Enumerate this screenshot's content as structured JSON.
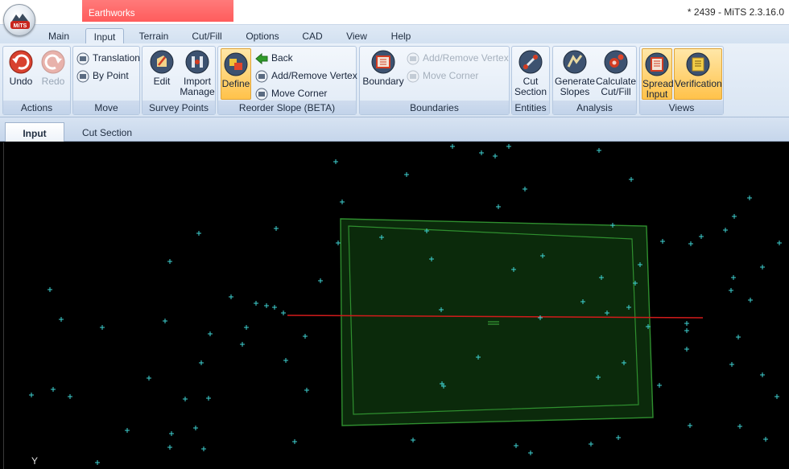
{
  "window": {
    "title": "* 2439 - MiTS 2.3.16.0",
    "context_tab": "Earthworks",
    "orb_text": "MiTS"
  },
  "ribbon_tabs": [
    "Main",
    "Input",
    "Terrain",
    "Cut/Fill",
    "Options",
    "CAD",
    "View",
    "Help"
  ],
  "active_ribbon_tab": "Input",
  "groups": {
    "actions": {
      "label": "Actions",
      "undo": "Undo",
      "redo": "Redo"
    },
    "move": {
      "label": "Move",
      "translation": "Translation",
      "by_point": "By Point"
    },
    "survey_points": {
      "label": "Survey Points",
      "edit": "Edit",
      "import_line1": "Import",
      "import_line2": "Manage"
    },
    "reorder_slope": {
      "label": "Reorder Slope (BETA)",
      "define": "Define",
      "back": "Back",
      "add_remove_vertex": "Add/Remove Vertex",
      "move_corner": "Move Corner"
    },
    "boundaries": {
      "label": "Boundaries",
      "boundary": "Boundary",
      "add_remove_vertex": "Add/Remove Vertex",
      "move_corner": "Move Corner"
    },
    "entities": {
      "label": "Entities",
      "cut_line1": "Cut",
      "cut_line2": "Section"
    },
    "analysis": {
      "label": "Analysis",
      "gen_line1": "Generate",
      "gen_line2": "Slopes",
      "calc_line1": "Calculate",
      "calc_line2": "Cut/Fill"
    },
    "views": {
      "label": "Views",
      "spread_line1": "Spread",
      "spread_line2": "Input",
      "verification": "Verification"
    }
  },
  "document_tabs": [
    "Input",
    "Cut Section"
  ],
  "active_document_tab": "Input",
  "canvas": {
    "axis_label": "Y",
    "colors": {
      "background": "#000000",
      "survey_point": "#3fd4d4",
      "boundary": "#2f8f2f",
      "boundary_fill": "#0b2a0b",
      "section_line": "#d21b1b"
    }
  },
  "icons": {
    "undo": "undo-icon",
    "redo": "redo-icon",
    "translation": "translation-icon",
    "by_point": "by-point-icon",
    "edit": "edit-icon",
    "import": "import-icon",
    "define": "define-icon",
    "back": "back-arrow-icon",
    "boundary": "boundary-icon",
    "cut_section": "cut-section-icon",
    "generate_slopes": "generate-slopes-icon",
    "calculate": "calculate-icon",
    "spread": "spread-input-icon",
    "verification": "verification-icon"
  }
}
